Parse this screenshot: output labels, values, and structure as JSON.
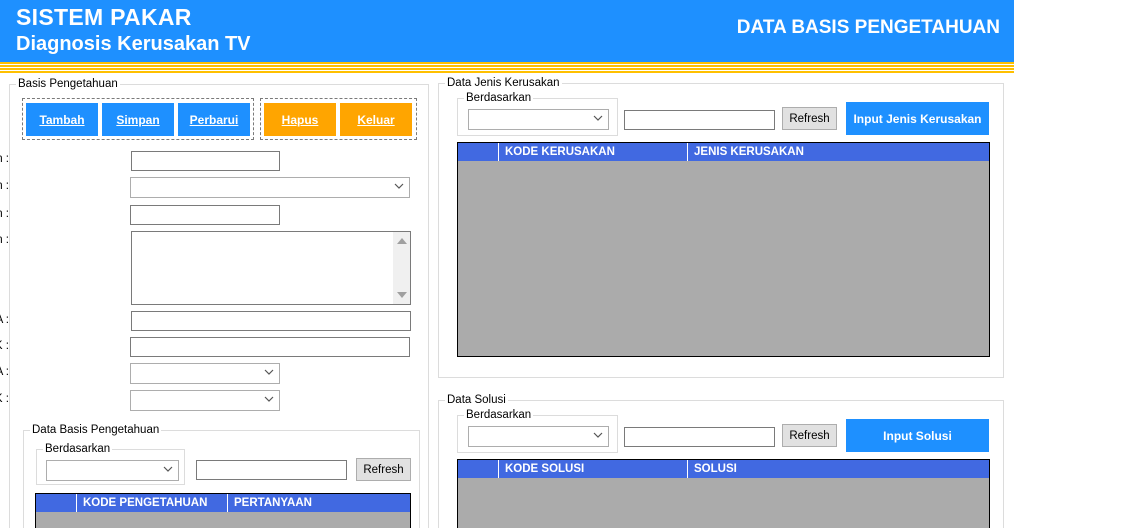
{
  "header": {
    "title": "SISTEM PAKAR",
    "subtitle": "Diagnosis Kerusakan TV",
    "page_title": "DATA BASIS PENGETAHUAN"
  },
  "basis": {
    "legend": "Basis Pengetahuan",
    "buttons": {
      "tambah": "Tambah",
      "simpan": "Simpan",
      "perbarui": "Perbarui",
      "hapus": "Hapus",
      "keluar": "Keluar"
    },
    "labels": {
      "kode_pengetahuan": "Kode Pengetahuan :",
      "kerusakan": "Kerusakan :",
      "kode_kerusakan": "Kode Kerusakan :",
      "pertanyaan": "Pertanyaan :",
      "fakta_ya": "Fakta YA :",
      "fakta_tidak": "Fakta TIDAK :",
      "jika_ya": "Jika YA :",
      "jika_tidak": "Jika TIDAK :"
    }
  },
  "data_basis": {
    "legend": "Data Basis Pengetahuan",
    "filter_legend": "Berdasarkan",
    "refresh": "Refresh",
    "columns": [
      "KODE PENGETAHUAN",
      "PERTANYAAN"
    ]
  },
  "jenis": {
    "legend": "Data Jenis Kerusakan",
    "filter_legend": "Berdasarkan",
    "refresh": "Refresh",
    "input_button": "Input Jenis Kerusakan",
    "columns": [
      "KODE KERUSAKAN",
      "JENIS KERUSAKAN"
    ]
  },
  "solusi": {
    "legend": "Data Solusi",
    "filter_legend": "Berdasarkan",
    "refresh": "Refresh",
    "input_button": "Input Solusi",
    "columns": [
      "KODE SOLUSI",
      "SOLUSI"
    ]
  },
  "colors": {
    "primary": "#1e90ff",
    "accent": "#ffa500",
    "stripe": "#ffc000",
    "grid_header": "#4169e1",
    "grid_body": "#ababab"
  }
}
